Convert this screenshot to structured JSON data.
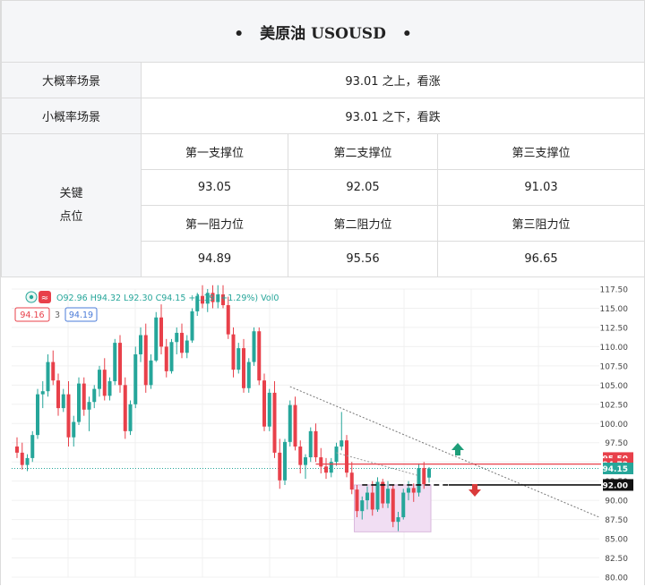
{
  "title": "美原油 USOUSD",
  "title_dots": [
    "•",
    "•"
  ],
  "scenarios": [
    {
      "label": "大概率场景",
      "value": "93.01 之上，看涨"
    },
    {
      "label": "小概率场景",
      "value": "93.01 之下，看跌"
    }
  ],
  "key_levels": {
    "label_line1": "关键",
    "label_line2": "点位",
    "support_headers": [
      "第一支撑位",
      "第二支撑位",
      "第三支撑位"
    ],
    "support_values": [
      "93.05",
      "92.05",
      "91.03"
    ],
    "resistance_headers": [
      "第一阻力位",
      "第二阻力位",
      "第三阻力位"
    ],
    "resistance_values": [
      "94.89",
      "95.56",
      "96.65"
    ]
  },
  "chart_data": {
    "type": "candlestick",
    "symbol_icon": "circle-dot-icon",
    "wave_icon": "wave-icon",
    "ohlc_text": "O92.96  H94.32  L92.30  C94.15  +1.19 (+1.29%)  Vol0",
    "bid": "94.16",
    "spread": "3",
    "ask": "94.19",
    "y_axis": {
      "min": 80.0,
      "max": 117.5,
      "ticks": [
        "117.50",
        "115.00",
        "112.50",
        "110.00",
        "107.50",
        "105.00",
        "102.50",
        "100.00",
        "97.50",
        "95.00",
        "92.50",
        "90.00",
        "87.50",
        "85.00",
        "82.50",
        "80.00"
      ]
    },
    "price_labels": [
      {
        "value": "95.50",
        "color": "#e8404a"
      },
      {
        "value": "94.72",
        "color": "#e8404a"
      },
      {
        "value": "94.15",
        "color": "#26a69a"
      },
      {
        "value": "92.00",
        "color": "#111111"
      }
    ],
    "up_color": "#26a69a",
    "down_color": "#e8404a",
    "resistance_line": 94.72,
    "support_line": 92.0,
    "range_box": {
      "low": 85.9,
      "high": 92.0
    },
    "candles": [
      [
        97.0,
        98.2,
        95.5,
        96.2
      ],
      [
        96.2,
        97.5,
        94.0,
        94.6
      ],
      [
        94.6,
        96.0,
        93.8,
        95.5
      ],
      [
        95.5,
        99.0,
        95.0,
        98.5
      ],
      [
        98.5,
        104.5,
        98.0,
        103.8
      ],
      [
        103.8,
        105.5,
        102.0,
        104.2
      ],
      [
        104.2,
        109.0,
        103.5,
        108.0
      ],
      [
        108.0,
        109.5,
        105.0,
        105.6
      ],
      [
        105.6,
        106.5,
        101.0,
        102.0
      ],
      [
        102.0,
        104.5,
        101.5,
        103.8
      ],
      [
        103.8,
        105.5,
        97.0,
        98.2
      ],
      [
        98.2,
        101.0,
        97.0,
        100.2
      ],
      [
        100.2,
        106.0,
        99.8,
        105.2
      ],
      [
        105.2,
        106.0,
        101.0,
        101.8
      ],
      [
        101.8,
        103.5,
        99.0,
        102.8
      ],
      [
        102.8,
        105.0,
        102.0,
        104.5
      ],
      [
        104.5,
        107.5,
        103.5,
        107.0
      ],
      [
        107.0,
        108.5,
        103.0,
        103.6
      ],
      [
        103.6,
        106.0,
        103.0,
        105.5
      ],
      [
        105.5,
        111.0,
        105.0,
        110.5
      ],
      [
        110.5,
        111.5,
        104.0,
        105.0
      ],
      [
        105.0,
        106.0,
        98.0,
        99.0
      ],
      [
        99.0,
        103.0,
        98.5,
        102.5
      ],
      [
        102.5,
        110.0,
        102.0,
        109.0
      ],
      [
        109.0,
        112.5,
        108.0,
        111.5
      ],
      [
        111.5,
        113.0,
        104.0,
        105.0
      ],
      [
        105.0,
        109.0,
        104.5,
        108.2
      ],
      [
        108.2,
        114.5,
        108.0,
        113.8
      ],
      [
        113.8,
        115.5,
        109.0,
        110.0
      ],
      [
        110.0,
        111.0,
        106.0,
        106.8
      ],
      [
        106.8,
        111.0,
        106.5,
        110.6
      ],
      [
        110.6,
        112.5,
        109.0,
        111.8
      ],
      [
        111.8,
        113.0,
        108.5,
        109.2
      ],
      [
        109.2,
        111.5,
        108.5,
        110.8
      ],
      [
        110.8,
        115.0,
        110.5,
        114.6
      ],
      [
        114.6,
        117.0,
        114.0,
        116.6
      ],
      [
        116.6,
        118.0,
        115.0,
        115.6
      ],
      [
        115.6,
        117.5,
        114.5,
        117.0
      ],
      [
        117.0,
        118.0,
        115.0,
        115.8
      ],
      [
        115.8,
        118.0,
        115.0,
        116.8
      ],
      [
        116.8,
        118.0,
        115.0,
        115.4
      ],
      [
        115.4,
        116.5,
        111.0,
        111.6
      ],
      [
        111.6,
        112.5,
        106.0,
        107.0
      ],
      [
        107.0,
        110.5,
        106.5,
        109.8
      ],
      [
        109.8,
        111.0,
        104.0,
        104.6
      ],
      [
        104.6,
        108.5,
        104.0,
        108.0
      ],
      [
        108.0,
        112.5,
        107.5,
        112.0
      ],
      [
        112.0,
        112.5,
        105.0,
        105.6
      ],
      [
        105.6,
        106.5,
        99.0,
        99.6
      ],
      [
        99.6,
        104.5,
        99.0,
        104.0
      ],
      [
        104.0,
        105.5,
        95.5,
        96.2
      ],
      [
        96.2,
        98.0,
        91.5,
        92.6
      ],
      [
        92.6,
        98.0,
        92.0,
        97.6
      ],
      [
        97.6,
        103.0,
        97.0,
        102.4
      ],
      [
        102.4,
        103.5,
        96.5,
        97.0
      ],
      [
        97.0,
        97.8,
        93.5,
        94.6
      ],
      [
        94.6,
        96.0,
        92.8,
        95.6
      ],
      [
        95.6,
        99.5,
        95.0,
        99.0
      ],
      [
        99.0,
        100.0,
        95.0,
        95.6
      ],
      [
        95.6,
        96.8,
        93.5,
        94.4
      ],
      [
        94.4,
        95.5,
        92.8,
        93.6
      ],
      [
        93.6,
        95.5,
        93.0,
        95.0
      ],
      [
        95.0,
        97.5,
        94.5,
        97.0
      ],
      [
        97.0,
        101.5,
        96.5,
        97.8
      ],
      [
        97.8,
        98.5,
        93.0,
        93.6
      ],
      [
        93.6,
        95.0,
        90.8,
        91.4
      ],
      [
        91.4,
        92.0,
        87.8,
        88.6
      ],
      [
        88.6,
        90.5,
        87.5,
        90.0
      ],
      [
        90.0,
        91.8,
        88.8,
        91.0
      ],
      [
        91.0,
        92.5,
        88.0,
        88.8
      ],
      [
        88.8,
        93.0,
        88.5,
        92.4
      ],
      [
        92.4,
        92.8,
        89.0,
        89.6
      ],
      [
        89.6,
        92.5,
        89.0,
        91.5
      ],
      [
        91.5,
        92.0,
        86.5,
        87.2
      ],
      [
        87.2,
        88.5,
        86.0,
        87.8
      ],
      [
        87.8,
        91.5,
        87.5,
        91.0
      ],
      [
        91.0,
        92.5,
        90.0,
        91.6
      ],
      [
        91.6,
        92.2,
        89.8,
        91.0
      ],
      [
        91.0,
        94.8,
        90.5,
        94.2
      ],
      [
        94.2,
        95.0,
        91.5,
        92.1
      ],
      [
        92.96,
        94.32,
        92.3,
        94.15
      ]
    ]
  }
}
